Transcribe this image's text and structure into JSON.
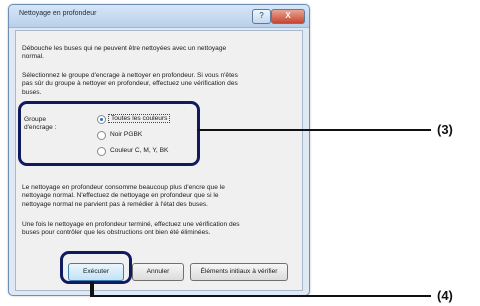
{
  "dialog": {
    "title": "Nettoyage en profondeur",
    "help_label": "?",
    "close_label": "X",
    "intro": [
      "Débouche les buses qui ne peuvent être nettoyées avec un nettoyage",
      "normal."
    ],
    "instruction": [
      "Sélectionnez le groupe d'encrage à nettoyer en profondeur. Si vous n'êtes",
      "pas sûr du groupe à nettoyer en profondeur, effectuez une vérification des",
      "buses."
    ],
    "group_label": [
      "Groupe",
      "d'encrage :"
    ],
    "options": [
      {
        "label": "Toutes les couleurs",
        "selected": true
      },
      {
        "label": "Noir   PGBK",
        "selected": false
      },
      {
        "label": "Couleur   C, M, Y, BK",
        "selected": false
      }
    ],
    "note1": [
      "Le nettoyage en profondeur consomme beaucoup plus d'encre que le",
      "nettoyage normal. N'effectuez de nettoyage en profondeur que si le",
      "nettoyage normal ne parvient pas à remédier à l'état des buses."
    ],
    "note2": [
      "Une fois le nettoyage en profondeur terminé, effectuez une vérification des",
      "buses pour contrôler que les obstructions ont bien été éliminées."
    ],
    "buttons": {
      "execute": "Exécuter",
      "cancel": "Annuler",
      "check_items": "Éléments initiaux à vérifier"
    }
  },
  "callouts": {
    "group": "(3)",
    "execute": "(4)"
  }
}
